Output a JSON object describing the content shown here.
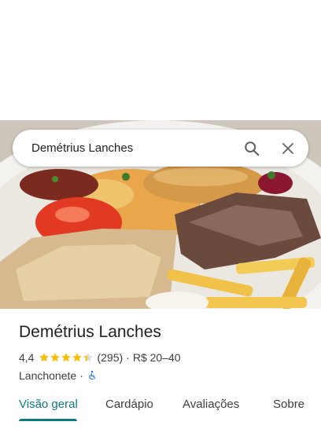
{
  "search": {
    "query": "Demétrius Lanches"
  },
  "place": {
    "name": "Demétrius Lanches",
    "rating": "4,4",
    "stars": 4.4,
    "review_count": "(295)",
    "price_separator": "·",
    "price_range": "R$ 20–40",
    "category": "Lanchonete",
    "category_separator": "·"
  },
  "tabs": [
    {
      "label": "Visão geral",
      "active": true
    },
    {
      "label": "Cardápio",
      "active": false
    },
    {
      "label": "Avaliações",
      "active": false
    },
    {
      "label": "Sobre",
      "active": false
    }
  ],
  "colors": {
    "accent": "#0b7b83",
    "star": "#fbbc04",
    "star_empty": "#dadce0"
  }
}
